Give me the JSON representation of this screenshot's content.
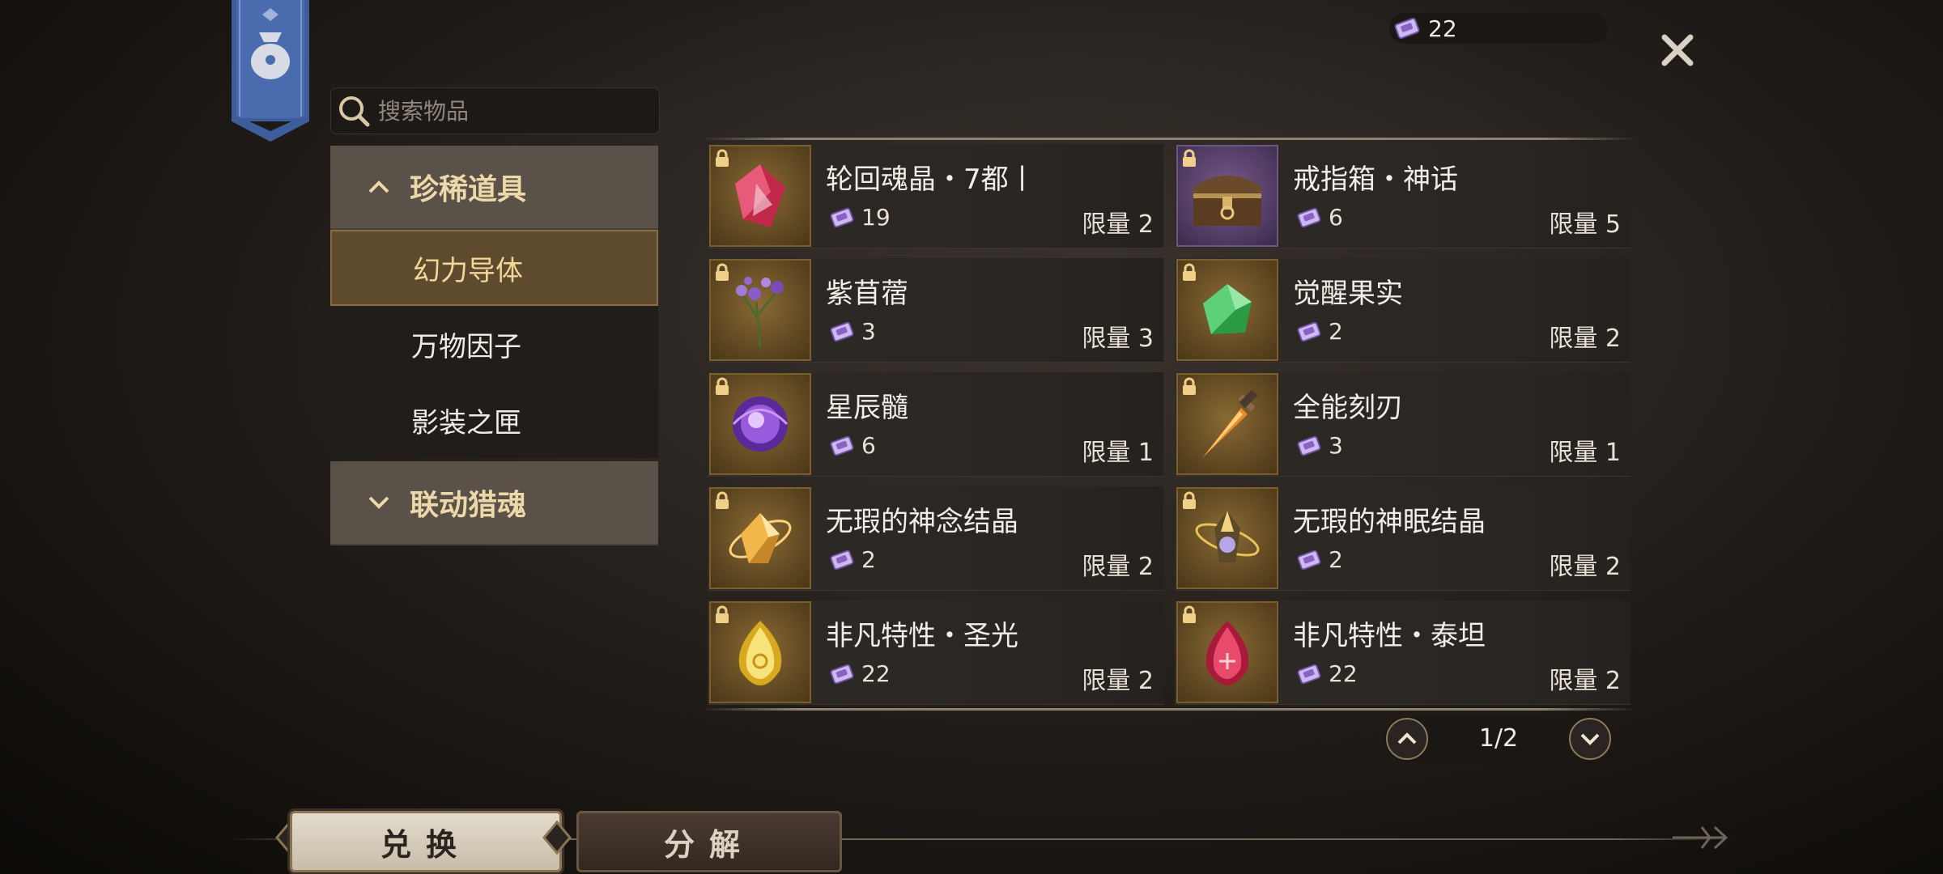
{
  "currency": {
    "icon": "purple-ticket-icon",
    "amount": "22"
  },
  "search": {
    "placeholder": "搜索物品"
  },
  "sidebar": {
    "categories": [
      {
        "label": "珍稀道具",
        "expanded": true
      },
      {
        "label": "联动猎魂",
        "expanded": false
      }
    ],
    "subitems": [
      {
        "label": "幻力导体",
        "active": true
      },
      {
        "label": "万物因子",
        "active": false
      },
      {
        "label": "影装之匣",
        "active": false
      }
    ]
  },
  "items": [
    {
      "name": "轮回魂晶・7都丨",
      "cost": "19",
      "limit": "限量 2",
      "icon": "red-crystal-icon"
    },
    {
      "name": "戒指箱・神话",
      "cost": "6",
      "limit": "限量 5",
      "icon": "treasure-chest-icon"
    },
    {
      "name": "紫苜蓿",
      "cost": "3",
      "limit": "限量 3",
      "icon": "purple-flower-icon"
    },
    {
      "name": "觉醒果实",
      "cost": "2",
      "limit": "限量 2",
      "icon": "green-fruit-icon"
    },
    {
      "name": "星辰髓",
      "cost": "6",
      "limit": "限量 1",
      "icon": "purple-orb-icon"
    },
    {
      "name": "全能刻刃",
      "cost": "3",
      "limit": "限量 1",
      "icon": "dagger-icon"
    },
    {
      "name": "无瑕的神念结晶",
      "cost": "2",
      "limit": "限量 2",
      "icon": "golden-crystal-icon"
    },
    {
      "name": "无瑕的神眠结晶",
      "cost": "2",
      "limit": "限量 2",
      "icon": "golden-orb-crystal-icon"
    },
    {
      "name": "非凡特性・圣光",
      "cost": "22",
      "limit": "限量 2",
      "icon": "yellow-gem-icon"
    },
    {
      "name": "非凡特性・泰坦",
      "cost": "22",
      "limit": "限量 2",
      "icon": "red-gem-icon"
    }
  ],
  "pager": {
    "value": "1/2"
  },
  "tabs": {
    "exchange": "兑换",
    "decompose": "分解"
  },
  "colors": {
    "accent_gold": "#ecd8a8",
    "active_bg": "#5e4a2c",
    "ticket_purple": "#b39ad8"
  }
}
